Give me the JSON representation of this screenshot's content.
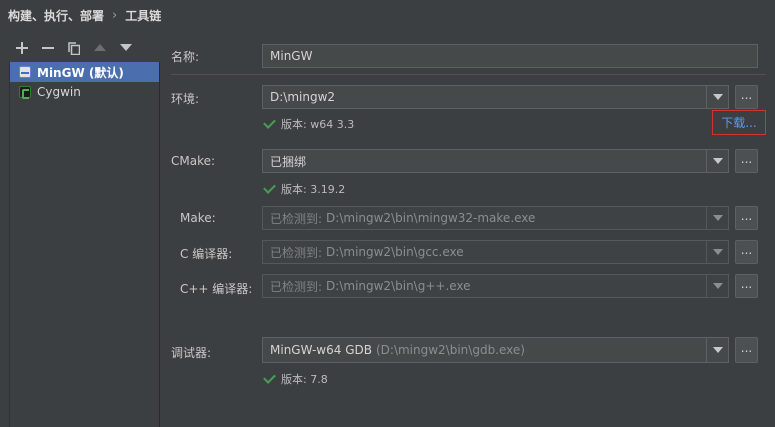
{
  "breadcrumb": {
    "parent": "构建、执行、部署",
    "separator": "›",
    "current": "工具链"
  },
  "toolbar": {
    "add": "add-icon",
    "remove": "remove-icon",
    "copy": "copy-icon",
    "move_up": "arrow-up-icon",
    "move_down": "arrow-down-icon"
  },
  "toolchains": [
    {
      "label": "MinGW (默认)",
      "icon": "mingw-icon",
      "selected": true
    },
    {
      "label": "Cygwin",
      "icon": "cygwin-icon",
      "selected": false
    }
  ],
  "form": {
    "name": {
      "label": "名称:",
      "value": "MinGW"
    },
    "environment": {
      "label": "环境:",
      "value": "D:\\mingw2",
      "status": "版本: w64 3.3",
      "download_link": "下载..."
    },
    "cmake": {
      "label": "CMake:",
      "value": "已捆绑",
      "status": "版本: 3.19.2"
    },
    "make": {
      "label": "Make:",
      "hint": "已检测到:",
      "value": "D:\\mingw2\\bin\\mingw32-make.exe"
    },
    "c_compiler": {
      "label": "C 编译器:",
      "hint": "已检测到:",
      "value": "D:\\mingw2\\bin\\gcc.exe"
    },
    "cpp_compiler": {
      "label": "C++ 编译器:",
      "hint": "已检测到:",
      "value": "D:\\mingw2\\bin\\g++.exe"
    },
    "debugger": {
      "label": "调试器:",
      "value": "MinGW-w64 GDB",
      "detail": "(D:\\mingw2\\bin\\gdb.exe)",
      "status": "版本: 7.8"
    },
    "browse_label": "..."
  },
  "colors": {
    "accent_selection": "#4b6eaf",
    "link": "#589df6",
    "ok_check": "#499c54",
    "highlight_border": "#d13232"
  }
}
